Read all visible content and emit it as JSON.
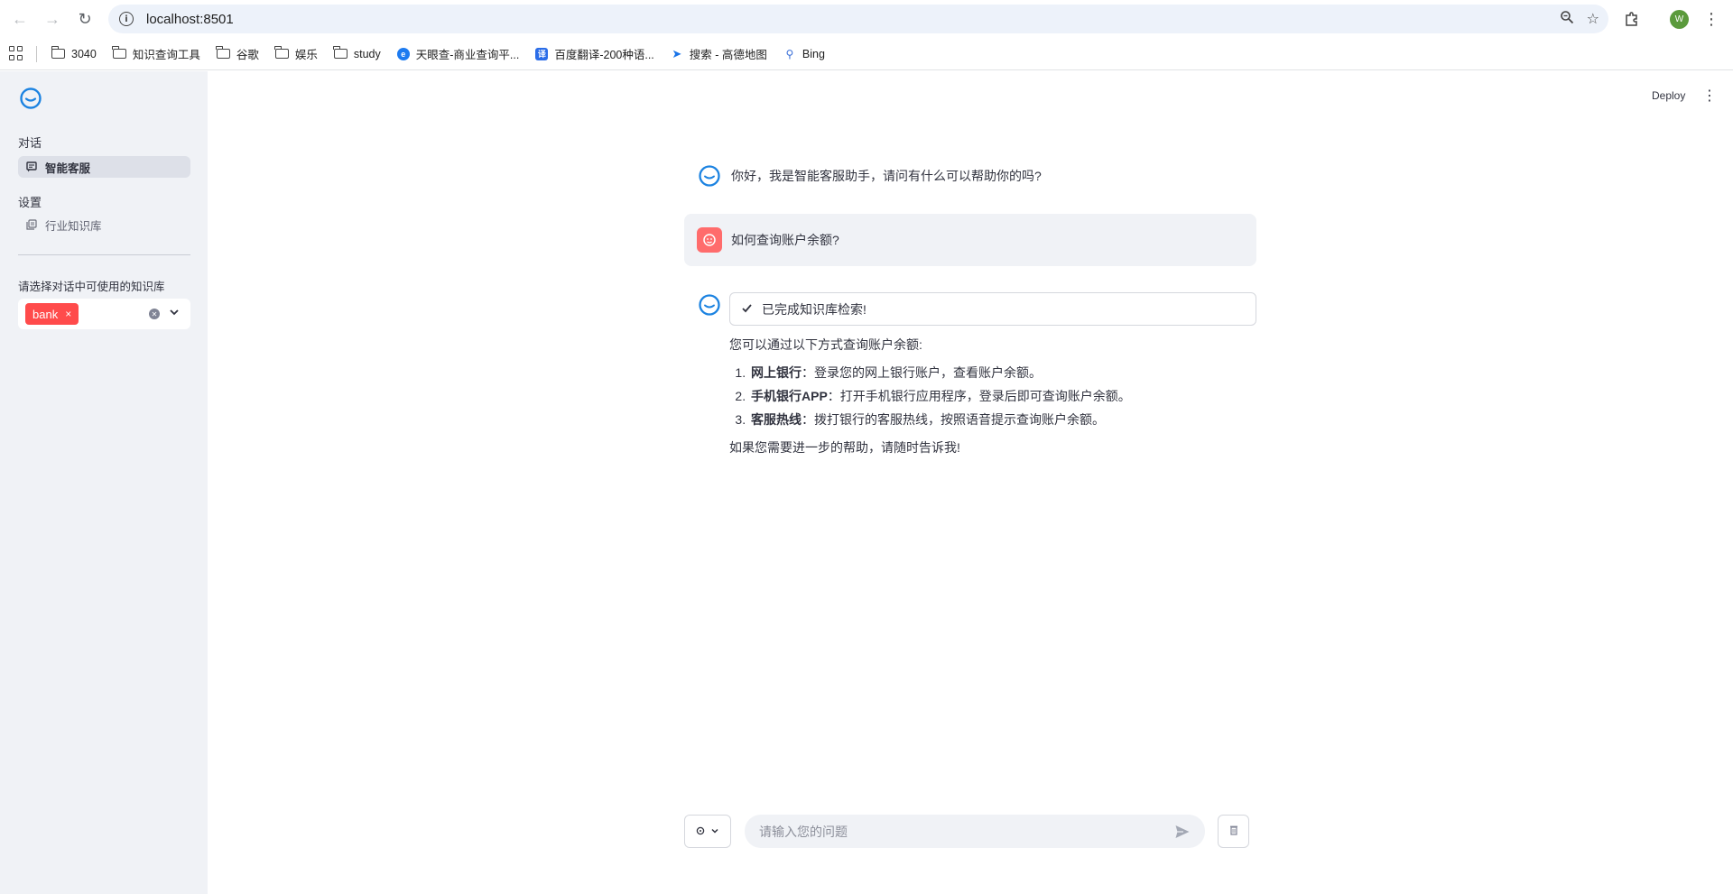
{
  "browser": {
    "url": "localhost:8501",
    "profile_initial": "W",
    "bookmarks": [
      {
        "label": "3040",
        "icon": "folder-icon"
      },
      {
        "label": "知识查询工具",
        "icon": "folder-icon"
      },
      {
        "label": "谷歌",
        "icon": "folder-icon"
      },
      {
        "label": "娱乐",
        "icon": "folder-icon"
      },
      {
        "label": "study",
        "icon": "folder-icon"
      },
      {
        "label": "天眼查-商业查询平...",
        "icon": "tianyancha-icon"
      },
      {
        "label": "百度翻译-200种语...",
        "icon": "baidu-translate-icon"
      },
      {
        "label": "搜索 - 高德地图",
        "icon": "amap-icon"
      },
      {
        "label": "Bing",
        "icon": "bing-search-icon"
      }
    ]
  },
  "sidebar": {
    "section_chat": "对话",
    "item_chat": "智能客服",
    "section_settings": "设置",
    "item_kb": "行业知识库",
    "select_label": "请选择对话中可使用的知识库",
    "selected_tag": "bank",
    "tag_remove": "×"
  },
  "header": {
    "deploy_label": "Deploy"
  },
  "chat": {
    "greeting": "你好，我是智能客服助手，请问有什么可以帮助你的吗?",
    "user_question": "如何查询账户余额?",
    "status": "已完成知识库检索!",
    "answer_intro": "您可以通过以下方式查询账户余额:",
    "answer_items": [
      {
        "title": "网上银行",
        "text": "：登录您的网上银行账户，查看账户余额。"
      },
      {
        "title": "手机银行APP",
        "text": "：打开手机银行应用程序，登录后即可查询账户余额。"
      },
      {
        "title": "客服热线",
        "text": "：拨打银行的客服热线，按照语音提示查询账户余额。"
      }
    ],
    "answer_outro": "如果您需要进一步的帮助，请随时告诉我!"
  },
  "input": {
    "placeholder": "请输入您的问题"
  },
  "colors": {
    "accent": "#ff4b4b",
    "assistant_icon": "#1c83e1",
    "user_avatar": "#ff6c6c",
    "sidebar_bg": "#f0f2f6"
  }
}
